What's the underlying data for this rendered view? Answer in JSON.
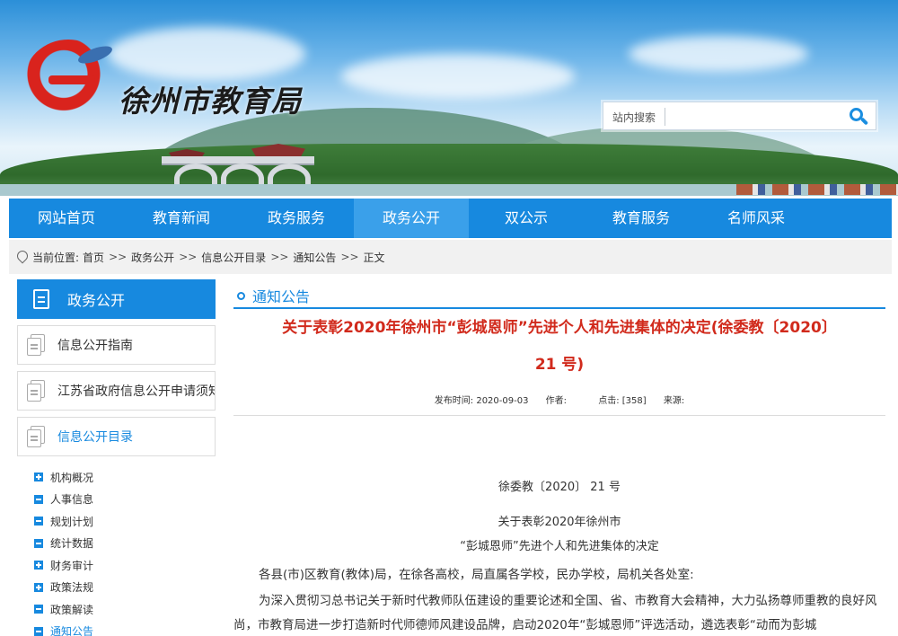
{
  "site": {
    "name": "徐州市教育局"
  },
  "search": {
    "label": "站内搜索",
    "placeholder": ""
  },
  "nav": {
    "items": [
      "网站首页",
      "教育新闻",
      "政务服务",
      "政务公开",
      "双公示",
      "教育服务",
      "名师风采"
    ],
    "active_index": 3
  },
  "breadcrumb": {
    "prefix": "当前位置:",
    "items": [
      "首页",
      "政务公开",
      "信息公开目录",
      "通知公告",
      "正文"
    ],
    "separator": ">>"
  },
  "sidebar": {
    "title": "政务公开",
    "boxes": [
      "信息公开指南",
      "江苏省政府信息公开申请须知",
      "信息公开目录"
    ],
    "tree": [
      {
        "label": "机构概况",
        "icon": "plus"
      },
      {
        "label": "人事信息",
        "icon": "minus"
      },
      {
        "label": "规划计划",
        "icon": "minus"
      },
      {
        "label": "统计数据",
        "icon": "minus"
      },
      {
        "label": "财务审计",
        "icon": "plus"
      },
      {
        "label": "政策法规",
        "icon": "plus"
      },
      {
        "label": "政策解读",
        "icon": "minus"
      },
      {
        "label": "通知公告",
        "icon": "minus"
      }
    ]
  },
  "main": {
    "section_title": "通知公告",
    "title_line1": "关于表彰2020年徐州市“彭城恩师”先进个人和先进集体的决定(徐委教〔2020〕",
    "title_line2": "21 号)",
    "meta": {
      "published": "发布时间: 2020-09-03",
      "author": "作者:",
      "clicks": "点击: [358]",
      "source": "来源:"
    },
    "doc_number": "徐委教〔2020〕 21 号",
    "subtitle1": "关于表彰2020年徐州市",
    "subtitle2": "“彭城恩师”先进个人和先进集体的决定",
    "salutation": "各县(市)区教育(教体)局，在徐各高校，局直属各学校，民办学校，局机关各处室:",
    "para1": "为深入贯彻习总书记关于新时代教师队伍建设的重要论述和全国、省、市教育大会精神，大力弘扬尊师重教的良好风尚，市教育局进一步打造新时代师德师风建设品牌，启动2020年“彭城恩师”评选活动，遴选表彰“动而为彭城"
  },
  "colors": {
    "primary": "#1789df",
    "nav_active": "#3aa0ea",
    "title_red": "#d12a1c",
    "logo_red": "#d9231d"
  }
}
